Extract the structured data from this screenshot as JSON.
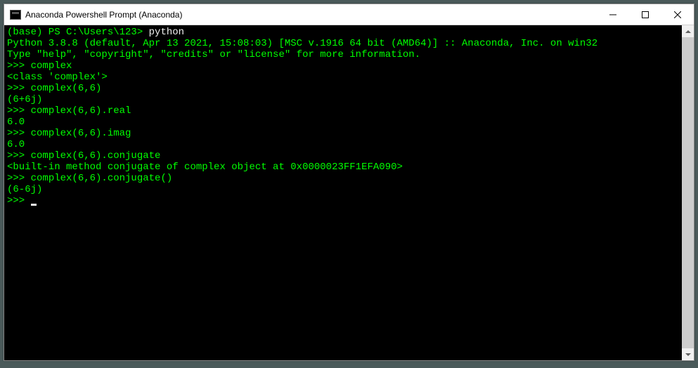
{
  "window": {
    "title": "Anaconda Powershell Prompt (Anaconda)"
  },
  "terminal": {
    "ps_prompt": "(base) PS C:\\Users\\123> ",
    "ps_command": "python",
    "line_version": "Python 3.8.8 (default, Apr 13 2021, 15:08:03) [MSC v.1916 64 bit (AMD64)] :: Anaconda, Inc. on win32",
    "line_help": "Type \"help\", \"copyright\", \"credits\" or \"license\" for more information.",
    "p1_prompt": ">>> ",
    "p1_input": "complex",
    "p1_output": "<class 'complex'>",
    "p2_prompt": ">>> ",
    "p2_input": "complex(6,6)",
    "p2_output": "(6+6j)",
    "p3_prompt": ">>> ",
    "p3_input": "complex(6,6).real",
    "p3_output": "6.0",
    "p4_prompt": ">>> ",
    "p4_input": "complex(6,6).imag",
    "p4_output": "6.0",
    "p5_prompt": ">>> ",
    "p5_input": "complex(6,6).conjugate",
    "p5_output": "<built-in method conjugate of complex object at 0x0000023FF1EFA090>",
    "p6_prompt": ">>> ",
    "p6_input": "complex(6,6).conjugate()",
    "p6_output": "(6-6j)",
    "p7_prompt": ">>> "
  }
}
